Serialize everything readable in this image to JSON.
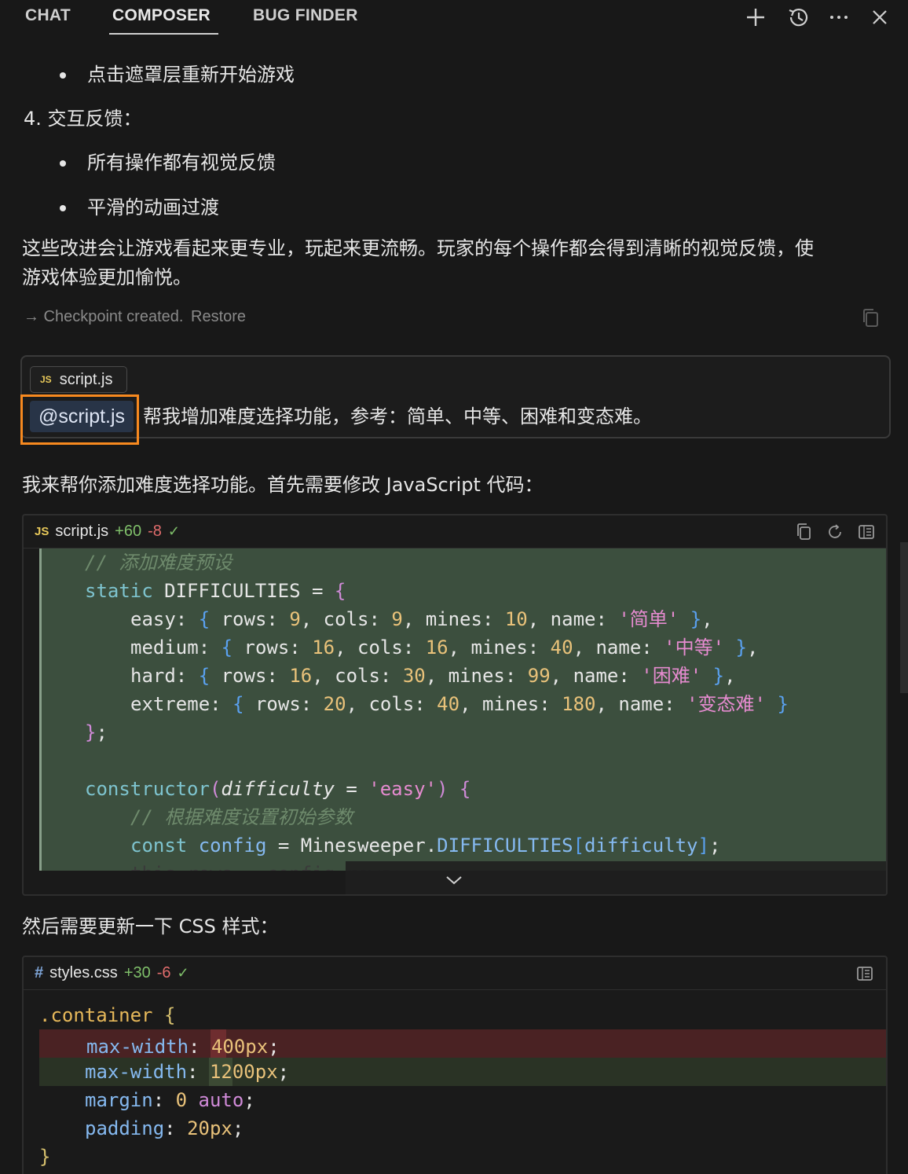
{
  "tabs": [
    {
      "label": "CHAT"
    },
    {
      "label": "COMPOSER"
    },
    {
      "label": "BUG FINDER"
    }
  ],
  "prose": {
    "bullet_restart": "点击遮罩层重新开始游戏",
    "item4": "4. 交互反馈：",
    "bullet_feedback": "所有操作都有视觉反馈",
    "bullet_anim": "平滑的动画过渡",
    "summary_line1": "这些改进会让游戏看起来更专业，玩起来更流畅。玩家的每个操作都会得到清晰的视觉反馈，使",
    "summary_line2": "游戏体验更加愉悦。"
  },
  "checkpoint": {
    "text": "→ Checkpoint created.",
    "restore": "Restore"
  },
  "user_message": {
    "file_badge": "JS",
    "file_name": "script.js",
    "mention": "@script.js",
    "text": "帮我增加难度选择功能，参考：简单、中等、困难和变态难。"
  },
  "assistant": {
    "intro_js": "我来帮你添加难度选择功能。首先需要修改 JavaScript 代码：",
    "intro_css": "然后需要更新一下 CSS 样式："
  },
  "js_block": {
    "badge": "JS",
    "file": "script.js",
    "added": "+60",
    "removed": "-8",
    "check": "✓",
    "lines": {
      "c1": "// 添加难度预设",
      "static": "static",
      "difficulties": "DIFFICULTIES",
      "easy_key": "easy",
      "easy_rows": "9",
      "easy_cols": "9",
      "easy_mines": "10",
      "easy_name": "'简单'",
      "medium_key": "medium",
      "medium_rows": "16",
      "medium_cols": "16",
      "medium_mines": "40",
      "medium_name": "'中等'",
      "hard_key": "hard",
      "hard_rows": "16",
      "hard_cols": "30",
      "hard_mines": "99",
      "hard_name": "'困难'",
      "extreme_key": "extreme",
      "extreme_rows": "20",
      "extreme_cols": "40",
      "extreme_mines": "180",
      "extreme_name": "'变态难'",
      "constructor": "constructor",
      "param": "difficulty",
      "default": "'easy'",
      "c2": "// 根据难度设置初始参数",
      "const": "const",
      "config": "config",
      "minesweeper": "Minesweeper",
      "faded": "this.rows = config.rows;"
    }
  },
  "css_block": {
    "badge": "#",
    "file": "styles.css",
    "added": "+30",
    "removed": "-6",
    "check": "✓",
    "lines": {
      "selector": ".container",
      "prop_maxwidth": "max-width",
      "old_value": "400px",
      "new_value": "1200px",
      "prop_margin": "margin",
      "margin_zero": "0",
      "margin_auto": "auto",
      "prop_padding": "padding",
      "padding_value": "20px"
    }
  },
  "colors": {
    "accent_highlight": "#f7891f",
    "added_line_bg": "#3c4f3e",
    "removed_line_bg": "#4a2223",
    "inserted_line_bg": "#2a3325"
  }
}
